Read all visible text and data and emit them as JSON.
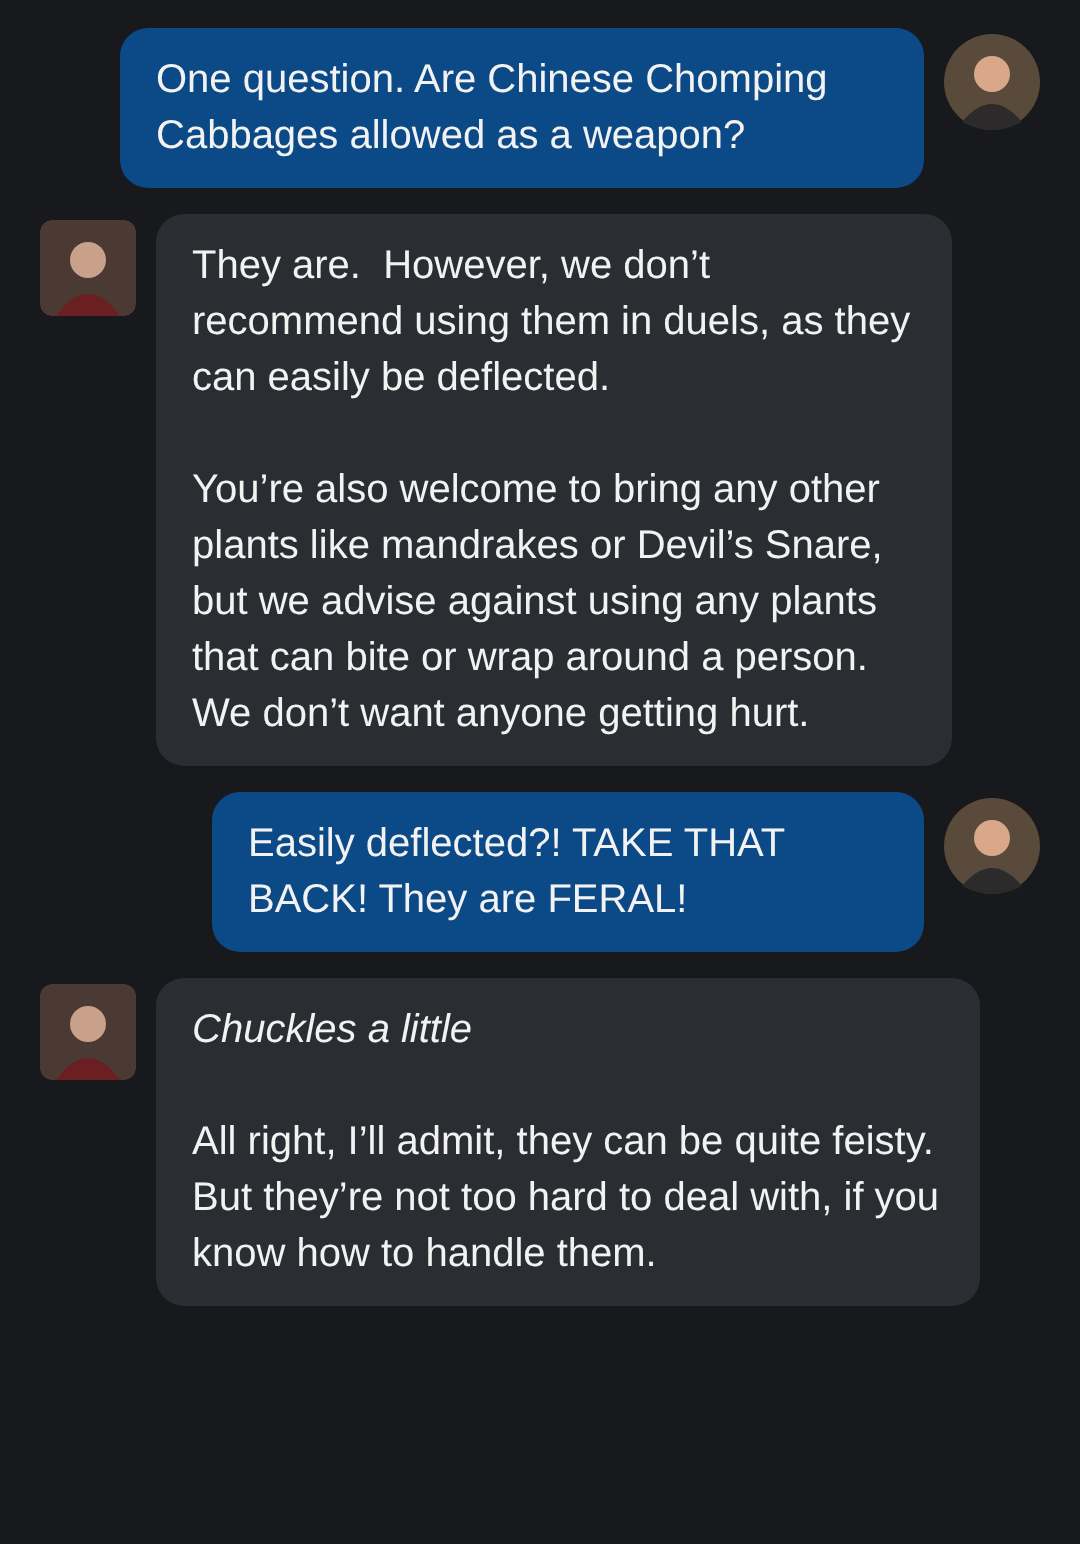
{
  "messages": [
    {
      "outgoing": true,
      "paragraphs": [
        {
          "kind": "speech",
          "text": "One question. Are Chinese Chomping Cabbages allowed as a weapon?"
        }
      ]
    },
    {
      "outgoing": false,
      "paragraphs": [
        {
          "kind": "speech",
          "text": "They are.  However, we don’t recommend using them in duels, as they can easily be deflected."
        },
        {
          "kind": "speech",
          "text": "You’re also welcome to bring any other plants like mandrakes or Devil’s Snare, but we advise against using any plants that can bite or wrap around a person.  We don’t want anyone getting hurt."
        }
      ]
    },
    {
      "outgoing": true,
      "paragraphs": [
        {
          "kind": "speech",
          "text": "Easily deflected?! TAKE THAT BACK! They are FERAL!"
        }
      ]
    },
    {
      "outgoing": false,
      "paragraphs": [
        {
          "kind": "action",
          "text": "Chuckles a little"
        },
        {
          "kind": "speech",
          "text": "All right, I’ll admit, they can be quite feisty.  But they’re not too hard to deal with, if you know how to handle them."
        }
      ]
    }
  ]
}
